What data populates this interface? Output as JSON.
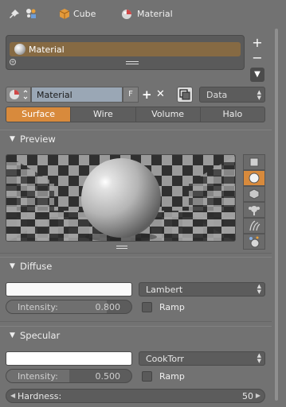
{
  "header": {
    "object_name": "Cube",
    "material_name": "Material"
  },
  "slots": {
    "items": [
      "Material"
    ],
    "add_label": "+",
    "remove_label": "−",
    "specials_label": "▼"
  },
  "datablock": {
    "name": "Material",
    "fake_user": "F",
    "new_label": "+",
    "unlink_label": "✕",
    "link_mode": "Data"
  },
  "tabs": [
    {
      "label": "Surface",
      "active": true
    },
    {
      "label": "Wire",
      "active": false
    },
    {
      "label": "Volume",
      "active": false
    },
    {
      "label": "Halo",
      "active": false
    }
  ],
  "preview": {
    "title": "Preview",
    "selected_shape": "sphere",
    "shapes": [
      "plane-icon",
      "sphere-icon",
      "cube-icon",
      "monkey-icon",
      "hair-icon",
      "sphere-sky-icon"
    ]
  },
  "diffuse": {
    "title": "Diffuse",
    "color": "#fafafa",
    "shader": "Lambert",
    "intensity_label": "Intensity:",
    "intensity_value": "0.800",
    "intensity_fraction": 0.8,
    "ramp_label": "Ramp",
    "ramp": false
  },
  "specular": {
    "title": "Specular",
    "color": "#ffffff",
    "shader": "CookTorr",
    "intensity_label": "Intensity:",
    "intensity_value": "0.500",
    "intensity_fraction": 0.5,
    "ramp_label": "Ramp",
    "ramp": false,
    "hardness_label": "Hardness:",
    "hardness_value": "50"
  },
  "colors": {
    "accent": "#d88a3c",
    "selected_slot": "#866a43",
    "name_field": "#9aa7b5"
  }
}
